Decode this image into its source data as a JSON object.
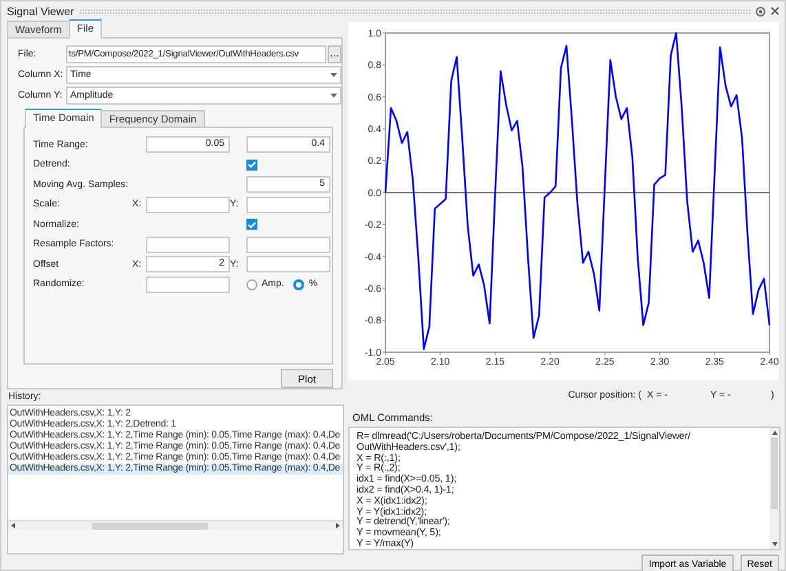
{
  "window": {
    "title": "Signal Viewer"
  },
  "tabs": [
    {
      "label": "Waveform",
      "selected": false
    },
    {
      "label": "File",
      "selected": true
    }
  ],
  "file_form": {
    "file_label": "File:",
    "file_value": "ts/PM/Compose/2022_1/SignalViewer/OutWithHeaders.csv",
    "browse_button": "...",
    "column_x_label": "Column X:",
    "column_x_value": "Time",
    "column_y_label": "Column Y:",
    "column_y_value": "Amplitude"
  },
  "domain_tabs": [
    {
      "label": "Time Domain",
      "selected": true
    },
    {
      "label": "Frequency Domain",
      "selected": false
    }
  ],
  "settings": [
    {
      "kind": "pair",
      "label": "Time Range:",
      "value_1": "0.05",
      "value_2": "0.4"
    },
    {
      "kind": "checkbox",
      "label": "Detrend:",
      "checked": true
    },
    {
      "kind": "single",
      "label": "Moving Avg. Samples:",
      "value": "5"
    },
    {
      "kind": "xy",
      "label": "Scale:",
      "x_label": "X:",
      "y_label": "Y:"
    },
    {
      "kind": "checkbox",
      "label": "Normalize:",
      "checked": true
    },
    {
      "kind": "pair",
      "label": "Resample Factors:"
    },
    {
      "kind": "xy",
      "label": "Offset",
      "x_label": "X:",
      "x_value": "2",
      "y_label": "Y:"
    },
    {
      "kind": "radio",
      "label": "Randomize:",
      "options": [
        {
          "label": "Amp.",
          "selected": false
        },
        {
          "label": "%",
          "selected": true
        }
      ]
    }
  ],
  "plot_button": "Plot",
  "chart": {
    "chart_data": {
      "type": "line",
      "x": [
        2.05,
        2.055,
        2.06,
        2.065,
        2.07,
        2.075,
        2.08,
        2.085,
        2.09,
        2.095,
        2.1,
        2.105,
        2.11,
        2.115,
        2.12,
        2.125,
        2.13,
        2.135,
        2.14,
        2.145,
        2.15,
        2.155,
        2.16,
        2.165,
        2.17,
        2.175,
        2.18,
        2.185,
        2.19,
        2.195,
        2.2,
        2.205,
        2.21,
        2.215,
        2.22,
        2.225,
        2.23,
        2.235,
        2.24,
        2.245,
        2.25,
        2.255,
        2.26,
        2.265,
        2.27,
        2.275,
        2.28,
        2.285,
        2.29,
        2.295,
        2.3,
        2.305,
        2.31,
        2.315,
        2.32,
        2.325,
        2.33,
        2.335,
        2.34,
        2.345,
        2.35,
        2.355,
        2.36,
        2.365,
        2.37,
        2.375,
        2.38,
        2.385,
        2.39,
        2.395,
        2.4
      ],
      "series": [
        {
          "color": "#0000ff",
          "values": [
            0,
            0.53,
            0.45,
            0.31,
            0.38,
            0.08,
            -0.41,
            -0.98,
            -0.84,
            -0.1,
            -0.07,
            -0.04,
            0.7,
            0.85,
            0.34,
            -0.21,
            -0.52,
            -0.45,
            -0.58,
            -0.82,
            -0.01,
            0.76,
            0.55,
            0.39,
            0.45,
            0.16,
            -0.41,
            -0.91,
            -0.77,
            -0.03,
            0,
            0.04,
            0.78,
            0.92,
            0.45,
            -0.07,
            -0.44,
            -0.37,
            -0.51,
            -0.74,
            0.05,
            0.83,
            0.6,
            0.46,
            0.53,
            0.22,
            -0.41,
            -0.83,
            -0.69,
            0.05,
            0.09,
            0.11,
            0.86,
            1,
            0.54,
            -0.05,
            -0.37,
            -0.3,
            -0.44,
            -0.66,
            0.11,
            0.91,
            0.67,
            0.54,
            0.61,
            0.34,
            -0.27,
            -0.76,
            -0.61,
            -0.54,
            -0.83
          ]
        }
      ],
      "xlim": [
        2.05,
        2.4
      ],
      "ylim": [
        -1,
        1
      ],
      "xticks": [
        {
          "value": 2.05,
          "label": "2.05"
        },
        {
          "value": 2.1,
          "label": "2.10"
        },
        {
          "value": 2.15,
          "label": "2.15"
        },
        {
          "value": 2.2,
          "label": "2.20"
        },
        {
          "value": 2.25,
          "label": "2.25"
        },
        {
          "value": 2.3,
          "label": "2.30"
        },
        {
          "value": 2.35,
          "label": "2.35"
        },
        {
          "value": 2.4,
          "label": "2.40"
        }
      ],
      "yticks": [
        {
          "value": -1,
          "label": "-1.0"
        },
        {
          "value": -0.8,
          "label": "-0.8"
        },
        {
          "value": -0.6,
          "label": "-0.6"
        },
        {
          "value": -0.4,
          "label": "-0.4"
        },
        {
          "value": -0.2,
          "label": "-0.2"
        },
        {
          "value": 0,
          "label": "0.0"
        },
        {
          "value": 0.2,
          "label": "0.2"
        },
        {
          "value": 0.4,
          "label": "0.4"
        },
        {
          "value": 0.6,
          "label": "0.6"
        },
        {
          "value": 0.8,
          "label": "0.8"
        },
        {
          "value": 1,
          "label": "1.0"
        }
      ]
    }
  },
  "cursor": {
    "label": "Cursor position: (",
    "x": "X = -",
    "y": "Y = -",
    "end": ")"
  },
  "history": {
    "label": "History:",
    "items": [
      {
        "text": "OutWithHeaders.csv,X: 1,Y: 2",
        "selected": false
      },
      {
        "text": "OutWithHeaders.csv,X: 1,Y: 2,Detrend: 1",
        "selected": false
      },
      {
        "text": "OutWithHeaders.csv,X: 1,Y: 2,Time Range (min): 0.05,Time Range (max): 0.4,De",
        "selected": false
      },
      {
        "text": "OutWithHeaders.csv,X: 1,Y: 2,Time Range (min): 0.05,Time Range (max): 0.4,De",
        "selected": false
      },
      {
        "text": "OutWithHeaders.csv,X: 1,Y: 2,Time Range (min): 0.05,Time Range (max): 0.4,De",
        "selected": false
      },
      {
        "text": "OutWithHeaders.csv,X: 1,Y: 2,Time Range (min): 0.05,Time Range (max): 0.4,De",
        "selected": true
      }
    ]
  },
  "commands": {
    "label": "OML Commands:",
    "lines": [
      "R= dlmread('C:/Users/roberta/Documents/PM/Compose/2022_1/SignalViewer/",
      "OutWithHeaders.csv',1);",
      "X = R(:,1);",
      "Y = R(:,2);",
      "idx1 = find(X>=0.05, 1);",
      "idx2 = find(X>0.4, 1)-1;",
      "X = X(idx1:idx2);",
      "Y = Y(idx1:idx2);",
      "Y = detrend(Y,'linear');",
      "Y = movmean(Y, 5);",
      "Y = Y/max(Y)"
    ]
  },
  "buttons": [
    "Import as Variable",
    "Reset"
  ]
}
